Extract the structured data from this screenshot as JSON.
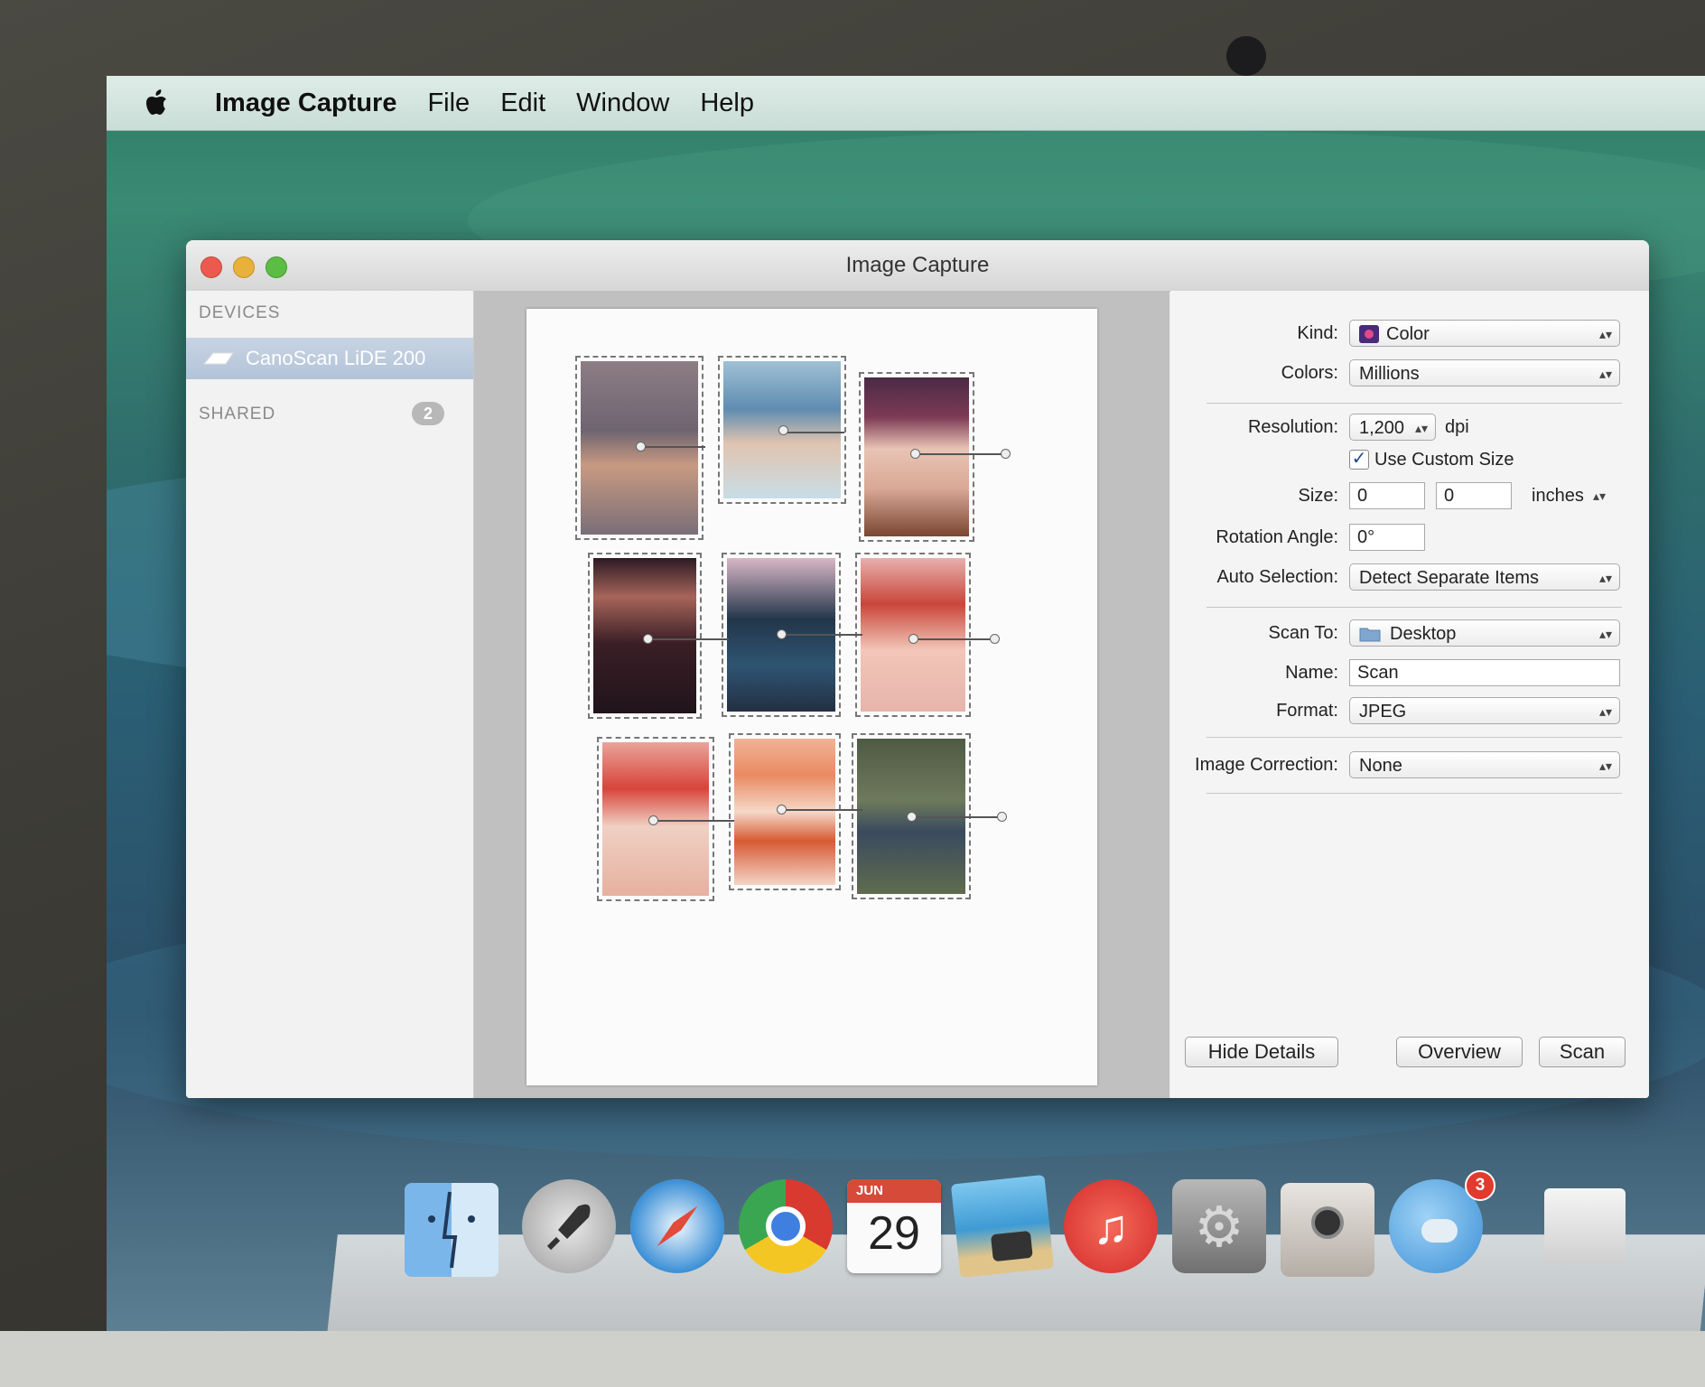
{
  "menubar": {
    "app_name": "Image Capture",
    "items": [
      "File",
      "Edit",
      "Window",
      "Help"
    ]
  },
  "window": {
    "title": "Image Capture"
  },
  "sidebar": {
    "devices_header": "DEVICES",
    "device_name": "CanoScan LiDE 200",
    "shared_header": "SHARED",
    "shared_count": "2"
  },
  "details": {
    "kind_label": "Kind:",
    "kind_value": "Color",
    "colors_label": "Colors:",
    "colors_value": "Millions",
    "resolution_label": "Resolution:",
    "resolution_value": "1,200",
    "resolution_unit": "dpi",
    "custom_size_label": "Use Custom Size",
    "custom_size_checked": true,
    "size_label": "Size:",
    "size_width": "0",
    "size_height": "0",
    "size_unit": "inches",
    "rotation_label": "Rotation Angle:",
    "rotation_value": "0°",
    "auto_selection_label": "Auto Selection:",
    "auto_selection_value": "Detect Separate Items",
    "scan_to_label": "Scan To:",
    "scan_to_value": "Desktop",
    "name_label": "Name:",
    "name_value": "Scan",
    "format_label": "Format:",
    "format_value": "JPEG",
    "correction_label": "Image Correction:",
    "correction_value": "None"
  },
  "buttons": {
    "hide_details": "Hide Details",
    "overview": "Overview",
    "scan": "Scan"
  },
  "dock": {
    "calendar_month": "JUN",
    "calendar_day": "29",
    "messages_badge": "3",
    "icons": [
      "finder-icon",
      "launchpad-icon",
      "safari-icon",
      "chrome-icon",
      "calendar-icon",
      "iphoto-icon",
      "itunes-icon",
      "system-preferences-icon",
      "image-capture-icon",
      "messages-icon",
      "documents-stack-icon"
    ]
  },
  "colors": {
    "close": "#ec5a4f",
    "minimize": "#e8b13a",
    "zoom": "#5bbd44",
    "selection": "#b7c6da"
  }
}
